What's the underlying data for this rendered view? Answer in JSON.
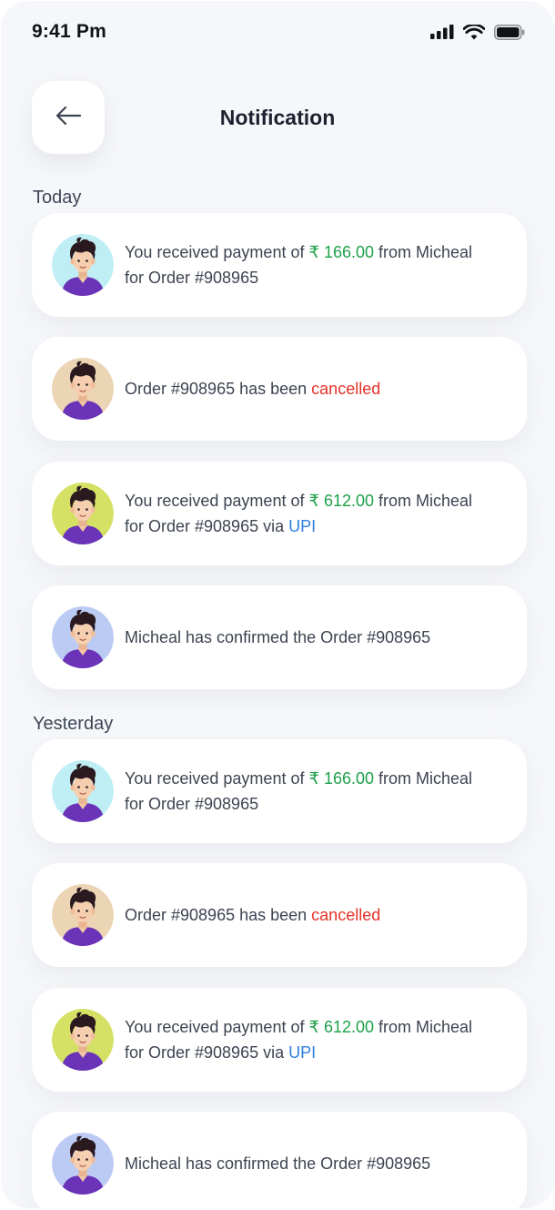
{
  "status_bar": {
    "time": "9:41 Pm",
    "icons": [
      "signal-icon",
      "wifi-icon",
      "battery-icon"
    ]
  },
  "header": {
    "back_icon": "arrow-left-icon",
    "title": "Notification"
  },
  "colors": {
    "amount": "#1ea04a",
    "cancelled": "#e53328",
    "upi": "#2f7fe0",
    "background": "#f6f7fa"
  },
  "sections": [
    {
      "label": "Today",
      "items": [
        {
          "avatar_bg": "#bfeef5",
          "type": "payment",
          "text_1": "You received payment of",
          "amount": "₹ 166.00",
          "text_2": "from Micheal",
          "text_3": "for Order #908965"
        },
        {
          "avatar_bg": "#ecd5b4",
          "type": "cancelled",
          "text_1": "Order #908965 has been",
          "status": "cancelled"
        },
        {
          "avatar_bg": "#d5e164",
          "type": "payment_upi",
          "text_1": "You received payment of",
          "amount": "₹ 612.00",
          "text_2": "from Micheal",
          "text_3": "for Order #908965 via",
          "method": "UPI"
        },
        {
          "avatar_bg": "#bccbf3",
          "type": "confirmed",
          "text_1": "Micheal has confirmed the Order #908965"
        }
      ]
    },
    {
      "label": "Yesterday",
      "items": [
        {
          "avatar_bg": "#bfeef5",
          "type": "payment",
          "text_1": "You received payment of",
          "amount": "₹ 166.00",
          "text_2": "from Micheal",
          "text_3": "for Order #908965"
        },
        {
          "avatar_bg": "#ecd5b4",
          "type": "cancelled",
          "text_1": "Order #908965 has been",
          "status": "cancelled"
        },
        {
          "avatar_bg": "#d5e164",
          "type": "payment_upi",
          "text_1": "You received payment of",
          "amount": "₹ 612.00",
          "text_2": "from Micheal",
          "text_3": "for Order #908965 via",
          "method": "UPI"
        },
        {
          "avatar_bg": "#bccbf3",
          "type": "confirmed",
          "text_1": "Micheal has confirmed the Order #908965"
        }
      ]
    }
  ]
}
